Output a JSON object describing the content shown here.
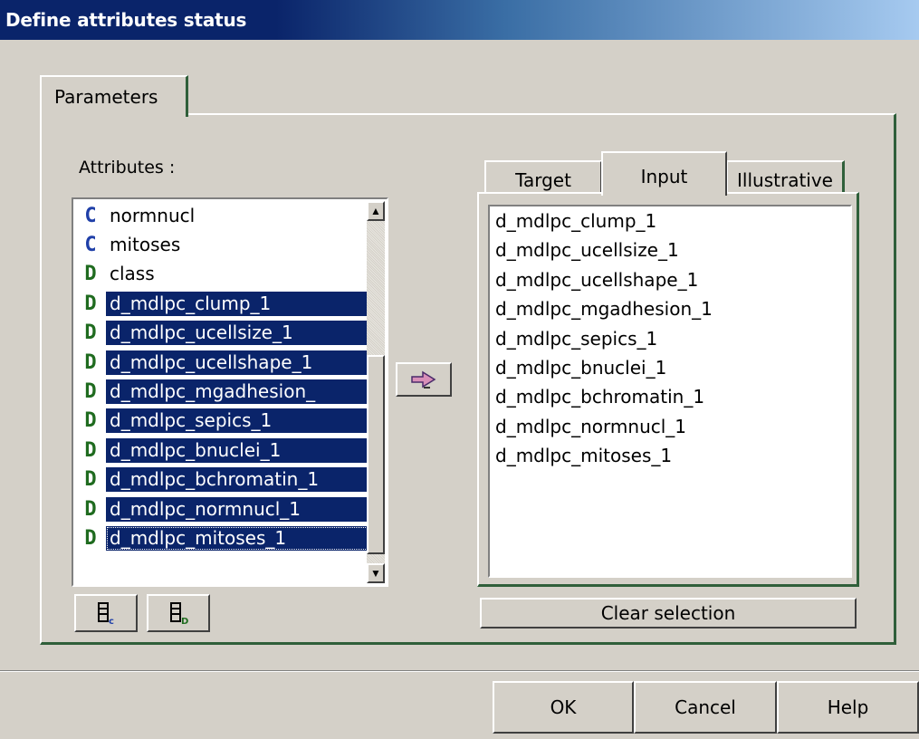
{
  "window": {
    "title": "Define attributes status"
  },
  "tabs": {
    "parameters": "Parameters"
  },
  "attributes_label": "Attributes :",
  "attributes": [
    {
      "icon": "C",
      "type": "continuous-attribute-icon",
      "label": "normnucl",
      "selected": false
    },
    {
      "icon": "C",
      "type": "continuous-attribute-icon",
      "label": "mitoses",
      "selected": false
    },
    {
      "icon": "D",
      "type": "discrete-attribute-icon",
      "label": "class",
      "selected": false
    },
    {
      "icon": "D",
      "type": "discrete-attribute-icon",
      "label": "d_mdlpc_clump_1",
      "selected": true
    },
    {
      "icon": "D",
      "type": "discrete-attribute-icon",
      "label": "d_mdlpc_ucellsize_1",
      "selected": true
    },
    {
      "icon": "D",
      "type": "discrete-attribute-icon",
      "label": "d_mdlpc_ucellshape_1",
      "selected": true
    },
    {
      "icon": "D",
      "type": "discrete-attribute-icon",
      "label": "d_mdlpc_mgadhesion_",
      "selected": true
    },
    {
      "icon": "D",
      "type": "discrete-attribute-icon",
      "label": "d_mdlpc_sepics_1",
      "selected": true
    },
    {
      "icon": "D",
      "type": "discrete-attribute-icon",
      "label": "d_mdlpc_bnuclei_1",
      "selected": true
    },
    {
      "icon": "D",
      "type": "discrete-attribute-icon",
      "label": "d_mdlpc_bchromatin_1",
      "selected": true
    },
    {
      "icon": "D",
      "type": "discrete-attribute-icon",
      "label": "d_mdlpc_normnucl_1",
      "selected": true
    },
    {
      "icon": "D",
      "type": "discrete-attribute-icon",
      "label": "d_mdlpc_mitoses_1",
      "selected": true,
      "focused": true
    }
  ],
  "role_tabs": {
    "target": "Target",
    "input": "Input",
    "illustrative": "Illustrative"
  },
  "input_attributes": [
    "d_mdlpc_clump_1",
    "d_mdlpc_ucellsize_1",
    "d_mdlpc_ucellshape_1",
    "d_mdlpc_mgadhesion_1",
    "d_mdlpc_sepics_1",
    "d_mdlpc_bnuclei_1",
    "d_mdlpc_bchromatin_1",
    "d_mdlpc_normnucl_1",
    "d_mdlpc_mitoses_1"
  ],
  "buttons": {
    "clear_selection": "Clear selection",
    "ok": "OK",
    "cancel": "Cancel",
    "help": "Help"
  },
  "colors": {
    "selection": "#0a246a",
    "continuous_icon": "#1f3fa8",
    "discrete_icon": "#1f6b1f",
    "frame": "#2f5f3a"
  }
}
